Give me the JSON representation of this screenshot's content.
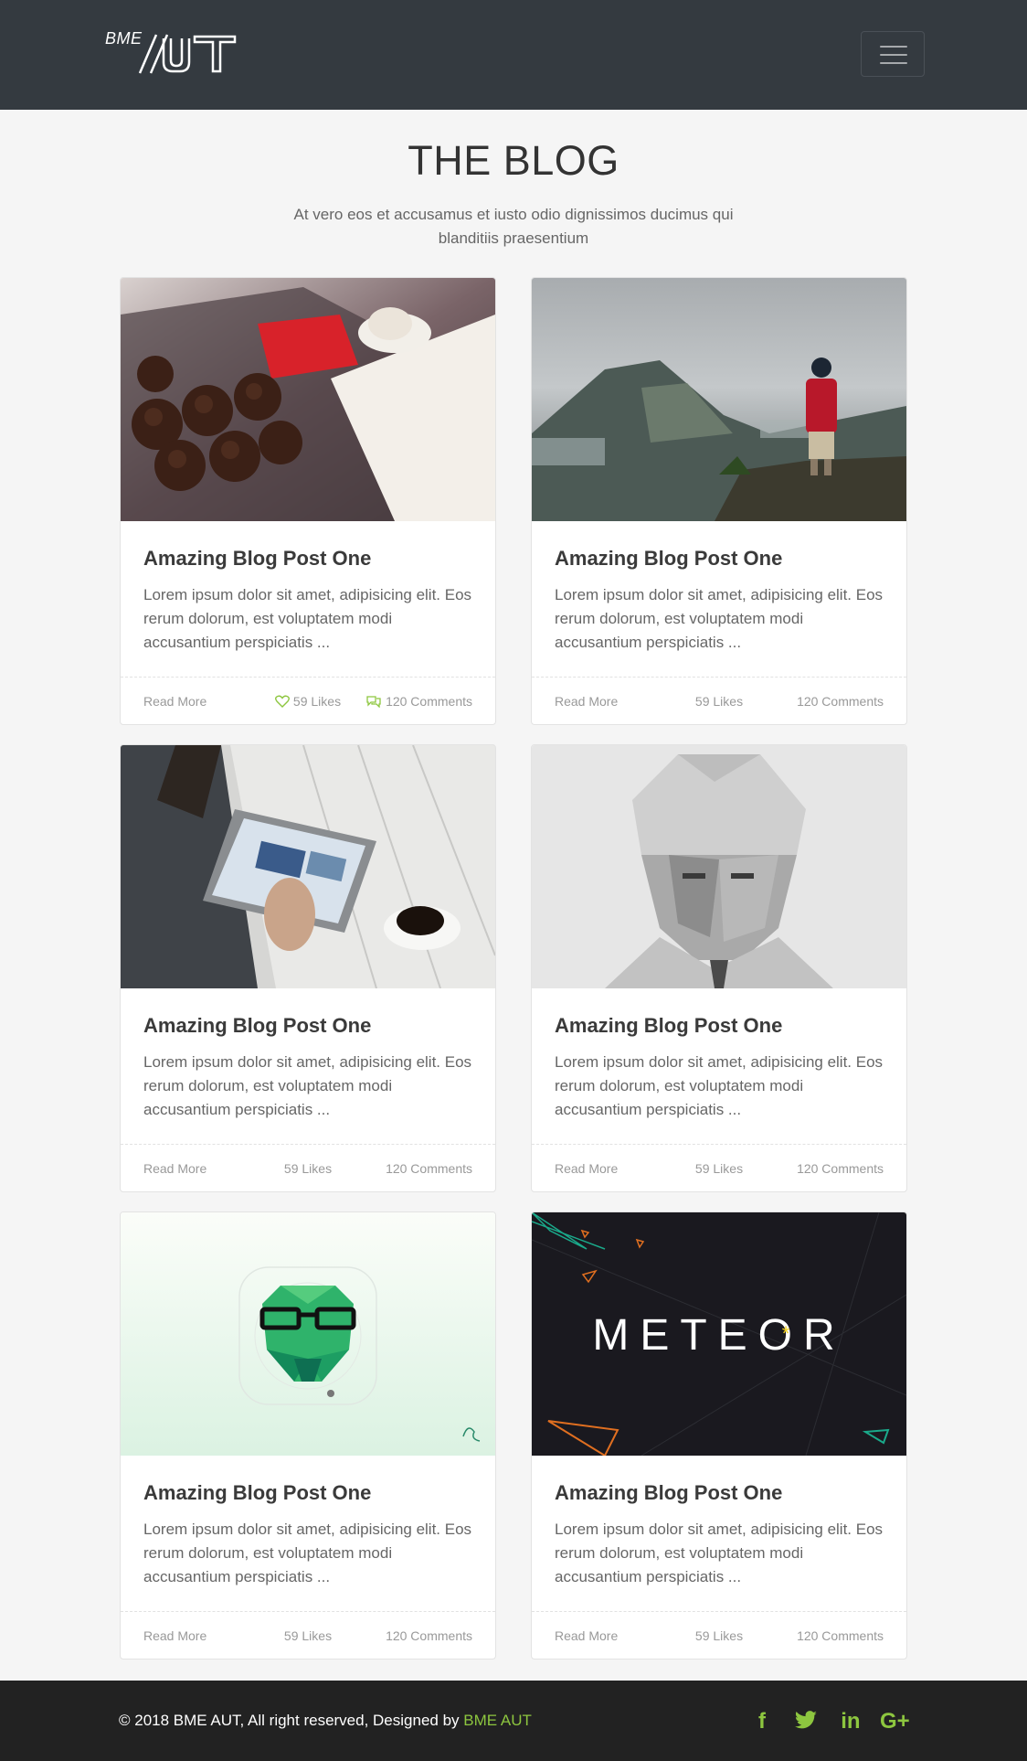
{
  "header": {
    "logo_small": "BME",
    "logo_alt": "BME AUT logo"
  },
  "main": {
    "title": "THE BLOG",
    "subtitle": "At vero eos et accusamus et iusto odio dignissimos ducimus qui blanditiis praesentium"
  },
  "posts": [
    {
      "title": "Amazing Blog Post One",
      "text": "Lorem ipsum dolor sit amet, adipisicing elit. Eos rerum dolorum, est voluptatem modi accusantium perspiciatis ...",
      "read_more": "Read More",
      "likes": "59 Likes",
      "comments": "120 Comments",
      "image": "muffins-book-coffee"
    },
    {
      "title": "Amazing Blog Post One",
      "text": "Lorem ipsum dolor sit amet, adipisicing elit. Eos rerum dolorum, est voluptatem modi accusantium perspiciatis ...",
      "read_more": "Read More",
      "likes": "59 Likes",
      "comments": "120 Comments",
      "image": "hiker-mountain"
    },
    {
      "title": "Amazing Blog Post One",
      "text": "Lorem ipsum dolor sit amet, adipisicing elit. Eos rerum dolorum, est voluptatem modi accusantium perspiciatis ...",
      "read_more": "Read More",
      "likes": "59 Likes",
      "comments": "120 Comments",
      "image": "tablet-coffee"
    },
    {
      "title": "Amazing Blog Post One",
      "text": "Lorem ipsum dolor sit amet, adipisicing elit. Eos rerum dolorum, est voluptatem modi accusantium perspiciatis ...",
      "read_more": "Read More",
      "likes": "59 Likes",
      "comments": "120 Comments",
      "image": "lowpoly-portrait"
    },
    {
      "title": "Amazing Blog Post One",
      "text": "Lorem ipsum dolor sit amet, adipisicing elit. Eos rerum dolorum, est voluptatem modi accusantium perspiciatis ...",
      "read_more": "Read More",
      "likes": "59 Likes",
      "comments": "120 Comments",
      "image": "bear-icon-art"
    },
    {
      "title": "Amazing Blog Post One",
      "text": "Lorem ipsum dolor sit amet, adipisicing elit. Eos rerum dolorum, est voluptatem modi accusantium perspiciatis ...",
      "read_more": "Read More",
      "likes": "59 Likes",
      "comments": "120 Comments",
      "image": "meteor-logo",
      "image_text": "METEOR"
    }
  ],
  "footer": {
    "copyright": "© 2018 BME AUT, All right reserved, Designed by ",
    "brand_link": "BME AUT",
    "social": [
      {
        "icon": "facebook-icon",
        "glyph": "f"
      },
      {
        "icon": "twitter-icon",
        "glyph": "🐦"
      },
      {
        "icon": "linkedin-icon",
        "glyph": "in"
      },
      {
        "icon": "google-plus-icon",
        "glyph": "G+"
      }
    ]
  },
  "colors": {
    "navbar": "#343a40",
    "accent": "#8dc63f",
    "footer": "#222222",
    "background": "#f5f5f5"
  }
}
